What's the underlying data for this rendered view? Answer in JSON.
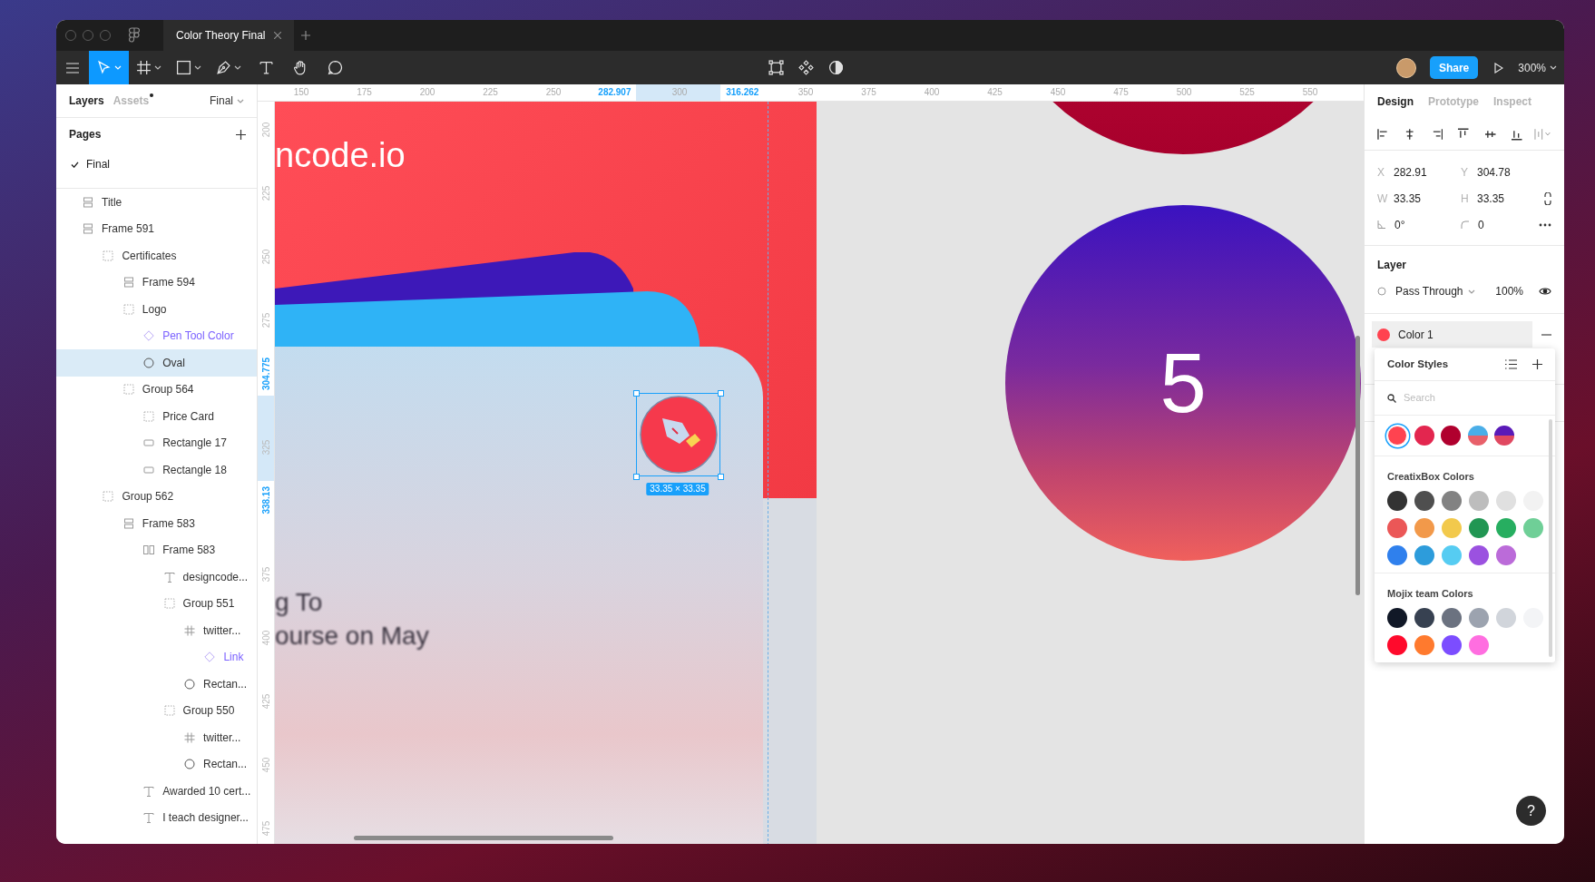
{
  "window": {
    "tab": {
      "label": "Color Theory Final",
      "selected": true
    }
  },
  "toolbar": {
    "tools": [
      {
        "kind": "move",
        "selected": true,
        "dropdown": true
      },
      {
        "kind": "frame",
        "selected": false,
        "dropdown": true
      },
      {
        "kind": "rectangle",
        "selected": false,
        "dropdown": true
      },
      {
        "kind": "pen",
        "selected": false,
        "dropdown": true
      },
      {
        "kind": "text",
        "selected": false,
        "dropdown": false
      },
      {
        "kind": "hand",
        "selected": false,
        "dropdown": false
      },
      {
        "kind": "comment",
        "selected": false,
        "dropdown": false
      }
    ],
    "center_tools": [
      {
        "kind": "edit-object"
      },
      {
        "kind": "component"
      },
      {
        "kind": "mask"
      }
    ],
    "share_button": "Share",
    "zoom": "300%"
  },
  "left_panel": {
    "tabs": [
      {
        "label": "Layers",
        "selected": true
      },
      {
        "label": "Assets",
        "selected": false
      }
    ],
    "page_selector": "Final",
    "pages_title": "Pages",
    "pages": [
      {
        "name": "Final",
        "selected": true
      }
    ],
    "layers": [
      {
        "name": "Title",
        "kind": "stack-vertical",
        "selected": false
      },
      {
        "name": "Frame 591",
        "kind": "stack-vertical",
        "selected": false,
        "children": [
          {
            "name": "Certificates",
            "kind": "group",
            "selected": false,
            "children": [
              {
                "name": "Frame 594",
                "kind": "stack-vertical",
                "selected": false
              },
              {
                "name": "Logo",
                "kind": "group",
                "selected": false,
                "children": [
                  {
                    "name": "Pen Tool Color",
                    "kind": "instance",
                    "selected": false
                  },
                  {
                    "name": "Oval",
                    "kind": "ellipse",
                    "selected": true
                  }
                ]
              },
              {
                "name": "Group 564",
                "kind": "group",
                "selected": false,
                "children": [
                  {
                    "name": "Price Card",
                    "kind": "group",
                    "selected": false
                  },
                  {
                    "name": "Rectangle 17",
                    "kind": "rectangle",
                    "selected": false
                  },
                  {
                    "name": "Rectangle 18",
                    "kind": "rectangle",
                    "selected": false
                  }
                ]
              }
            ]
          },
          {
            "name": "Group 562",
            "kind": "group",
            "selected": false,
            "children": [
              {
                "name": "Frame 583",
                "kind": "stack-vertical",
                "selected": false,
                "children": [
                  {
                    "name": "Frame 583",
                    "kind": "stack-horizontal",
                    "selected": false,
                    "children": [
                      {
                        "name": "designcode...",
                        "kind": "text",
                        "selected": false
                      },
                      {
                        "name": "Group 551",
                        "kind": "group",
                        "selected": false,
                        "children": [
                          {
                            "name": "twitter...",
                            "kind": "frame",
                            "selected": false,
                            "children": [
                              {
                                "name": "Link",
                                "kind": "instance",
                                "selected": false
                              }
                            ]
                          },
                          {
                            "name": "Rectan...",
                            "kind": "ellipse",
                            "selected": false
                          }
                        ]
                      },
                      {
                        "name": "Group 550",
                        "kind": "group",
                        "selected": false,
                        "children": [
                          {
                            "name": "twitter...",
                            "kind": "frame",
                            "selected": false
                          },
                          {
                            "name": "Rectan...",
                            "kind": "ellipse",
                            "selected": false
                          }
                        ]
                      }
                    ]
                  },
                  {
                    "name": "Awarded 10 cert...",
                    "kind": "text",
                    "selected": false
                  },
                  {
                    "name": "I teach designer...",
                    "kind": "text",
                    "selected": false
                  }
                ]
              }
            ]
          }
        ]
      }
    ]
  },
  "rulers": {
    "horizontal": [
      {
        "value": "150",
        "kind": "tick"
      },
      {
        "value": "175",
        "kind": "tick"
      },
      {
        "value": "200",
        "kind": "tick"
      },
      {
        "value": "225",
        "kind": "tick"
      },
      {
        "value": "250",
        "kind": "tick"
      },
      {
        "value": "282.907",
        "kind": "selection_start"
      },
      {
        "value": "300",
        "kind": "tick"
      },
      {
        "value": "316.262",
        "kind": "selection_end"
      },
      {
        "value": "350",
        "kind": "tick"
      },
      {
        "value": "375",
        "kind": "tick"
      },
      {
        "value": "400",
        "kind": "tick"
      },
      {
        "value": "425",
        "kind": "tick"
      },
      {
        "value": "450",
        "kind": "tick"
      },
      {
        "value": "475",
        "kind": "tick"
      },
      {
        "value": "500",
        "kind": "tick"
      },
      {
        "value": "525",
        "kind": "tick"
      },
      {
        "value": "550",
        "kind": "tick"
      }
    ],
    "vertical": [
      {
        "value": "200",
        "kind": "tick"
      },
      {
        "value": "225",
        "kind": "tick"
      },
      {
        "value": "250",
        "kind": "tick"
      },
      {
        "value": "275",
        "kind": "tick"
      },
      {
        "value": "304.775",
        "kind": "selection_start"
      },
      {
        "value": "325",
        "kind": "tick"
      },
      {
        "value": "338.13",
        "kind": "selection_end"
      },
      {
        "value": "375",
        "kind": "tick"
      },
      {
        "value": "400",
        "kind": "tick"
      },
      {
        "value": "425",
        "kind": "tick"
      },
      {
        "value": "450",
        "kind": "tick"
      },
      {
        "value": "475",
        "kind": "tick"
      }
    ]
  },
  "canvas": {
    "heading": "ncode.io",
    "blurred_lines": [
      "g To",
      "ourse on May"
    ],
    "number": "5",
    "selection_size": "33.35 × 33.35"
  },
  "right_panel": {
    "tabs": [
      {
        "label": "Design",
        "selected": true
      },
      {
        "label": "Prototype",
        "selected": false
      },
      {
        "label": "Inspect",
        "selected": false
      }
    ],
    "position": [
      {
        "label": "X",
        "value": "282.91"
      },
      {
        "label": "Y",
        "value": "304.78"
      },
      {
        "label": "W",
        "value": "33.35"
      },
      {
        "label": "H",
        "value": "33.35"
      }
    ],
    "rotation": "0°",
    "corner_radius": "0",
    "layer": {
      "title": "Layer",
      "blend_mode": "Pass Through",
      "opacity": "100%",
      "visible": true
    },
    "fill": {
      "name": "Color 1",
      "color": "#ff4350"
    },
    "color_styles": {
      "title": "Color Styles",
      "placeholder": "Search",
      "document_swatches": [
        {
          "kind": "solid",
          "color": "#ff4350",
          "selected": true
        },
        {
          "kind": "solid",
          "color": "#e3264f",
          "selected": false
        },
        {
          "kind": "solid",
          "color": "#b0002e",
          "selected": false
        },
        {
          "kind": "gradient",
          "stops": [
            {
              "color": "#4aaee8"
            },
            {
              "color": "#e8606a"
            }
          ],
          "selected": false
        },
        {
          "kind": "gradient",
          "stops": [
            {
              "color": "#5a1ab8"
            },
            {
              "color": "#e04860"
            }
          ],
          "selected": false
        }
      ],
      "libraries": [
        {
          "name": "CreatixBox Colors",
          "swatches": [
            {
              "color": "#333333"
            },
            {
              "color": "#4f4f4f"
            },
            {
              "color": "#828282"
            },
            {
              "color": "#bdbdbd"
            },
            {
              "color": "#e0e0e0"
            },
            {
              "color": "#f2f2f2"
            },
            {
              "color": "#eb5757"
            },
            {
              "color": "#f2994a"
            },
            {
              "color": "#f2c94c"
            },
            {
              "color": "#219653"
            },
            {
              "color": "#27ae60"
            },
            {
              "color": "#6fcf97"
            },
            {
              "color": "#2f80ed"
            },
            {
              "color": "#2d9cdb"
            },
            {
              "color": "#56ccf2"
            },
            {
              "color": "#9b51e0"
            },
            {
              "color": "#bb6bd9"
            }
          ]
        },
        {
          "name": "Mojix team Colors",
          "swatches": [
            {
              "color": "#111827"
            },
            {
              "color": "#374151"
            },
            {
              "color": "#6b7280"
            },
            {
              "color": "#9ca3af"
            },
            {
              "color": "#d1d5db"
            },
            {
              "color": "#f3f4f6"
            },
            {
              "color": "#ff0a2c"
            },
            {
              "color": "#ff7a2e"
            },
            {
              "color": "#7c4dff"
            },
            {
              "color": "#ff6ee0"
            }
          ]
        }
      ]
    }
  },
  "help_button": "?"
}
